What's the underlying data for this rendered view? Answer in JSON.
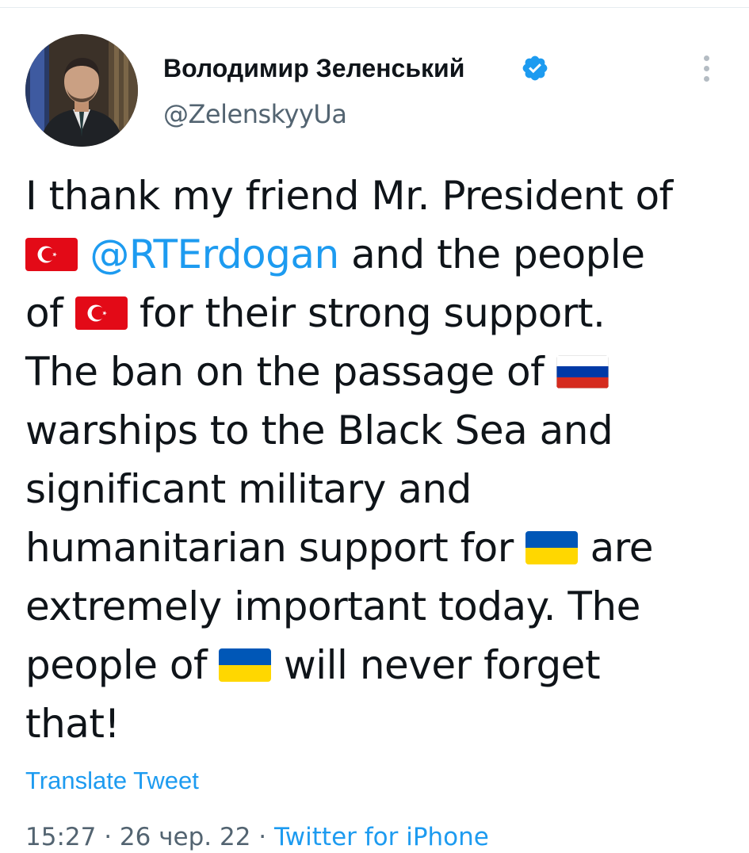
{
  "author": {
    "name": "Володимир Зеленський",
    "handle": "@ZelenskyyUa",
    "verified": true
  },
  "icons": {
    "verified": "verified-badge-icon",
    "more": "more-vertical-icon",
    "flag_turkey": "turkey-flag-icon",
    "flag_russia": "russia-flag-icon",
    "flag_ukraine": "ukraine-flag-icon"
  },
  "colors": {
    "link": "#1d9bf0",
    "secondary_text": "#536471",
    "primary_text": "#0f1419",
    "verified": "#1d9bf0"
  },
  "tweet": {
    "line1": "I thank my friend Mr. President of",
    "mention": "@RTErdogan",
    "line2_rest": " and the people",
    "line3_start": "of ",
    "line3_rest": " for their strong support.",
    "line4_start": "The ban on the passage of ",
    "line5": "warships to the Black Sea and",
    "line6": "significant military and",
    "line7_start": "humanitarian support for ",
    "line7_rest": " are",
    "line8": "extremely important today. The",
    "line9_start": "people of ",
    "line9_rest": " will never forget",
    "line10": "that!"
  },
  "translate_label": "Translate Tweet",
  "meta": {
    "time": "15:27",
    "separator": " · ",
    "date": "26 чер. 22",
    "source": "Twitter for iPhone"
  }
}
